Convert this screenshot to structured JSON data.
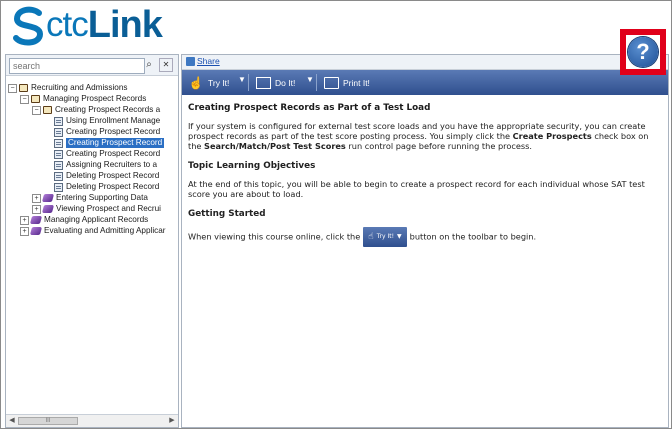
{
  "header": {
    "logo_part1": "ctc",
    "logo_part2": "Link",
    "help_glyph": "?"
  },
  "left_panel": {
    "search_placeholder": "search",
    "search_icon": "magnifier-icon",
    "close_icon": "close-x-icon",
    "tree": [
      {
        "label": "Recruiting and Admissions",
        "icon": "book-icon",
        "expander": "−"
      },
      {
        "label": "Managing Prospect Records",
        "icon": "book-icon",
        "expander": "−"
      },
      {
        "label": "Creating Prospect Records a",
        "icon": "book-icon",
        "expander": "−"
      },
      {
        "label": "Using Enrollment Manage",
        "icon": "page-icon"
      },
      {
        "label": "Creating Prospect Record",
        "icon": "page-icon"
      },
      {
        "label": "Creating Prospect Record",
        "icon": "page-icon",
        "selected": true
      },
      {
        "label": "Creating Prospect Record",
        "icon": "page-icon"
      },
      {
        "label": "Assigning Recruiters to a",
        "icon": "page-icon"
      },
      {
        "label": "Deleting Prospect Record",
        "icon": "page-icon"
      },
      {
        "label": "Deleting Prospect Record",
        "icon": "page-icon"
      },
      {
        "label": "Entering Supporting Data",
        "icon": "gem-icon",
        "expander": "+"
      },
      {
        "label": "Viewing Prospect and Recrui",
        "icon": "gem-icon",
        "expander": "+"
      },
      {
        "label": "Managing Applicant Records",
        "icon": "gem-icon",
        "expander": "+"
      },
      {
        "label": "Evaluating and Admitting Applicar",
        "icon": "gem-icon",
        "expander": "+"
      }
    ],
    "scroll_left": "◀",
    "scroll_right": "▶",
    "scroll_thumb": "III"
  },
  "right_panel": {
    "share_label": "Share",
    "toolbar": {
      "try_label": "Try It!",
      "do_label": "Do It!",
      "print_label": "Print It!"
    },
    "title": "Creating Prospect Records as Part of a Test Load",
    "intro_part1": "If your system is configured for external test score loads and you have the appropriate security, you can create prospect records as part of the test score posting process. You simply click the ",
    "intro_bold1": "Create Prospects",
    "intro_part2": " check box on the ",
    "intro_bold2": "Search/Match/Post Test Scores",
    "intro_part3": " run control page before running the process.",
    "objectives_heading": "Topic Learning Objectives",
    "objectives_text": "At the end of this topic, you will be able to begin to create a prospect record for each individual whose SAT test score you are about to load.",
    "getting_started_heading": "Getting Started",
    "getting_started_before": "When viewing this course online, click the",
    "inline_button_label": "Try It!",
    "getting_started_after": "button on the toolbar to begin."
  },
  "colors": {
    "logo_blue": "#0a77b9",
    "toolbar_blue": "#2f4f8e",
    "highlight_red": "#e0001a",
    "selection_blue": "#2b6fc4"
  }
}
